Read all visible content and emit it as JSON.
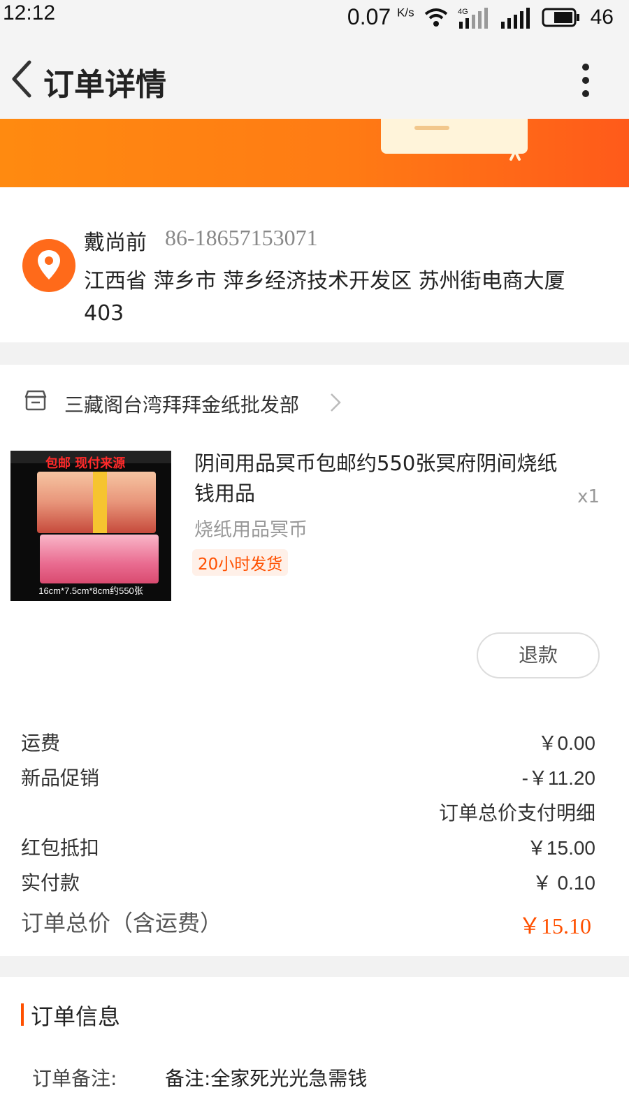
{
  "status_bar": {
    "time": "12:12",
    "speed": "0.07",
    "speed_unit": "K/s",
    "network": "4G",
    "battery": "46"
  },
  "header": {
    "title": "订单详情"
  },
  "address": {
    "name": "戴尚前",
    "phone": "86-18657153071",
    "line": "江西省 萍乡市 萍乡经济技术开发区 苏州街电商大厦403"
  },
  "shop": {
    "name": "三藏阁台湾拜拜金纸批发部"
  },
  "product": {
    "title": "阴间用品冥币包邮约550张冥府阴间烧纸钱用品",
    "qty": "x1",
    "sku": "烧纸用品冥币",
    "tag": "20小时发货",
    "image_caption": "16cm*7.5cm*8cm约550张",
    "image_banner": "包邮 现付来源"
  },
  "actions": {
    "refund": "退款"
  },
  "fees": [
    {
      "label": "运费",
      "value": "￥0.00"
    },
    {
      "label": "新品促销",
      "value": "-￥11.20"
    },
    {
      "label": "红包抵扣",
      "value": "￥15.00"
    },
    {
      "label": "实付款",
      "value": "￥ 0.10"
    }
  ],
  "fee_note": "订单总价支付明细",
  "total": {
    "label": "订单总价（含运费）",
    "value": "￥15.10"
  },
  "order_info": {
    "title": "订单信息",
    "remark_label": "订单备注:",
    "remark_value": "备注:全家死光光急需钱"
  },
  "colors": {
    "accent": "#ff5000",
    "banner_start": "#ff8a10",
    "banner_end": "#ff5a1a"
  }
}
